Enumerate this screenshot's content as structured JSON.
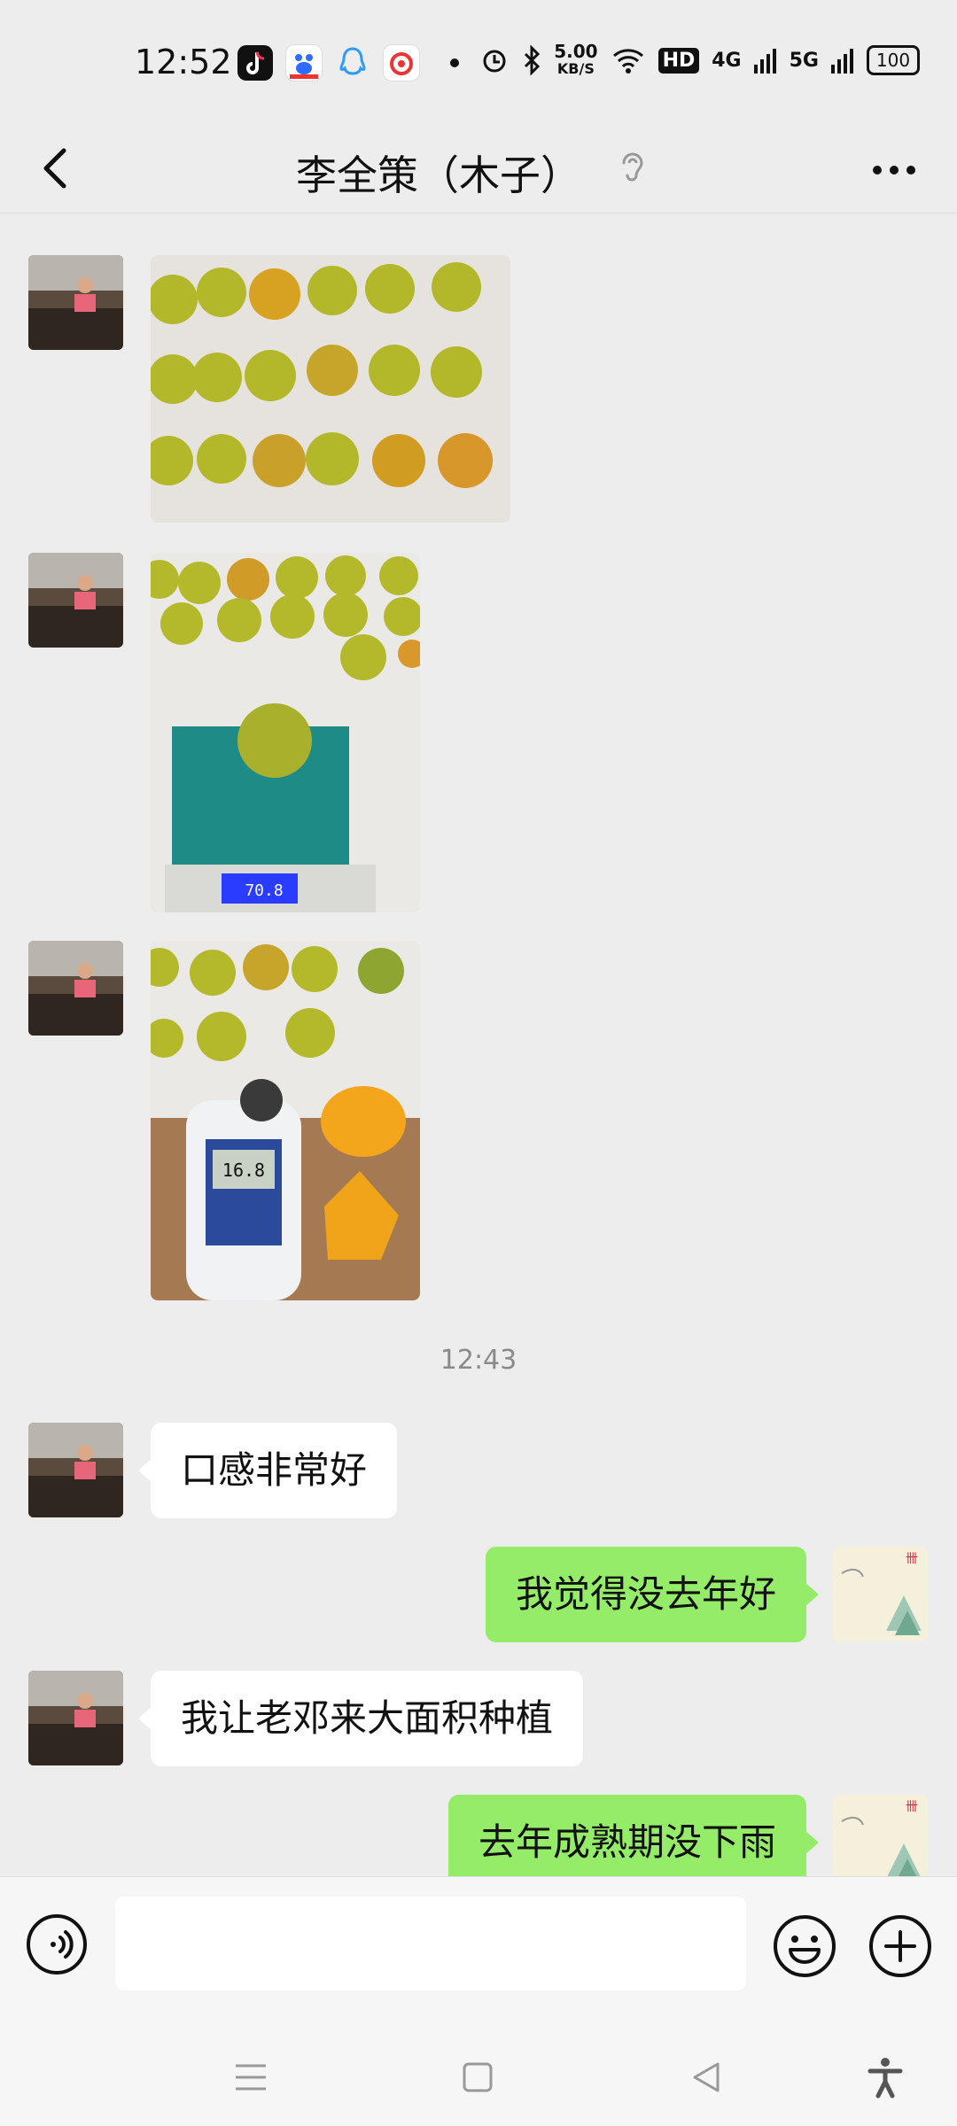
{
  "status_bar": {
    "time": "12:52",
    "speed_value": "5.00",
    "speed_unit": "KB/S",
    "hd_label": "HD",
    "net1": "4G",
    "net2": "5G",
    "battery": "100"
  },
  "header": {
    "title": "李全策（木子）"
  },
  "chat": {
    "timestamp": "12:43",
    "messages": [
      {
        "side": "left",
        "text": "口感非常好"
      },
      {
        "side": "right",
        "text": "我觉得没去年好"
      },
      {
        "side": "left",
        "text": "我让老邓来大面积种植"
      },
      {
        "side": "right",
        "text": "去年成熟期没下雨"
      }
    ]
  },
  "input": {
    "value": "",
    "placeholder": ""
  },
  "colors": {
    "sent_bubble": "#95ec69",
    "received_bubble": "#ffffff",
    "background": "#ededed"
  }
}
